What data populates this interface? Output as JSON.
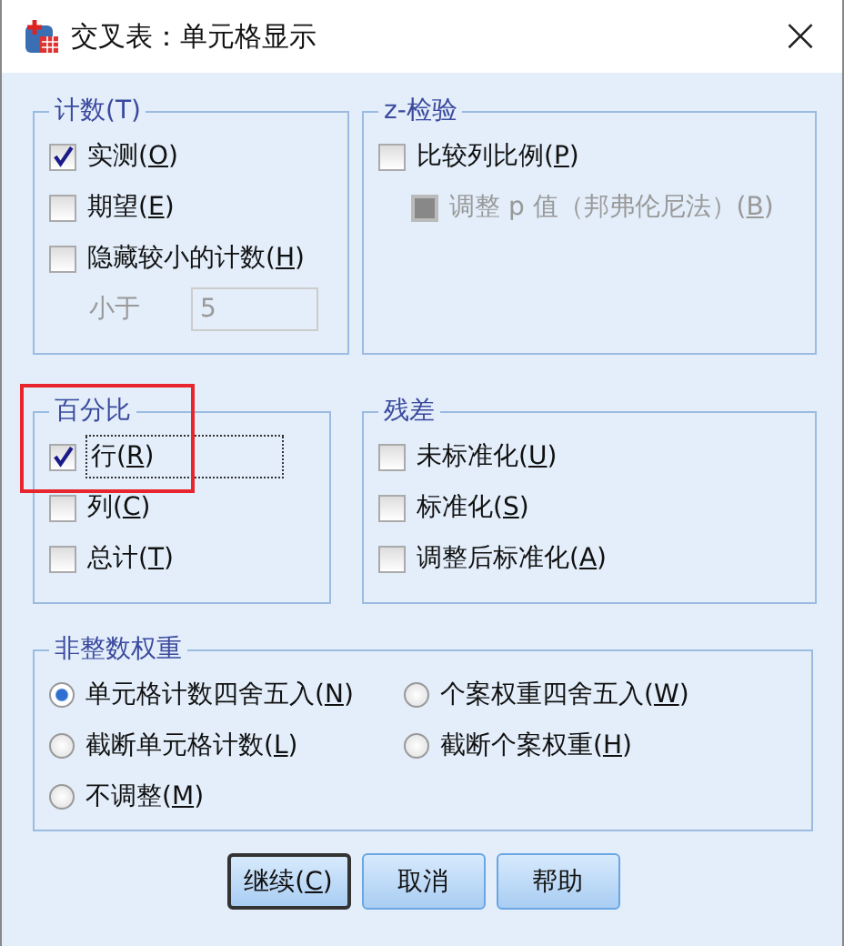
{
  "window": {
    "title": "交叉表：单元格显示",
    "close": "×"
  },
  "counts": {
    "legend": "计数(T)",
    "items": [
      {
        "before": "实测(",
        "mnemonic": "O",
        "after": ")",
        "checked": true,
        "disabled": false
      },
      {
        "before": "期望(",
        "mnemonic": "E",
        "after": ")",
        "checked": false,
        "disabled": false
      },
      {
        "before": "隐藏较小的计数(",
        "mnemonic": "H",
        "after": ")",
        "checked": false,
        "disabled": false
      }
    ],
    "less_than": {
      "label": "小于",
      "value": "5",
      "disabled": true
    }
  },
  "z_test": {
    "legend": "z-检验",
    "items": [
      {
        "before": "比较列比例(",
        "mnemonic": "P",
        "after": ")",
        "checked": false,
        "disabled": false,
        "children": [
          {
            "before": "调整 p 值（邦弗伦尼法）(",
            "mnemonic": "B",
            "after": ")",
            "checked": false,
            "disabled": true
          }
        ]
      }
    ]
  },
  "percentages": {
    "legend": "百分比",
    "highlighted": true,
    "items": [
      {
        "before": "行(",
        "mnemonic": "R",
        "after": ")",
        "checked": true,
        "disabled": false,
        "focused": true
      },
      {
        "before": "列(",
        "mnemonic": "C",
        "after": ")",
        "checked": false,
        "disabled": false,
        "focused": false
      },
      {
        "before": "总计(",
        "mnemonic": "T",
        "after": ")",
        "checked": false,
        "disabled": false,
        "focused": false
      }
    ]
  },
  "residuals": {
    "legend": "残差",
    "items": [
      {
        "before": "未标准化(",
        "mnemonic": "U",
        "after": ")",
        "checked": false,
        "disabled": false
      },
      {
        "before": "标准化(",
        "mnemonic": "S",
        "after": ")",
        "checked": false,
        "disabled": false
      },
      {
        "before": "调整后标准化(",
        "mnemonic": "A",
        "after": ")",
        "checked": false,
        "disabled": false
      }
    ]
  },
  "noninteger_weights": {
    "legend": "非整数权重",
    "options": [
      {
        "before": "单元格计数四舍五入(",
        "mnemonic": "N",
        "after": ")",
        "selected": true
      },
      {
        "before": "个案权重四舍五入(",
        "mnemonic": "W",
        "after": ")",
        "selected": false
      },
      {
        "before": "截断单元格计数(",
        "mnemonic": "L",
        "after": ")",
        "selected": false
      },
      {
        "before": "截断个案权重(",
        "mnemonic": "H",
        "after": ")",
        "selected": false
      },
      {
        "before": "不调整(",
        "mnemonic": "M",
        "after": ")",
        "selected": false
      }
    ]
  },
  "buttons": [
    {
      "before": "继续(",
      "mnemonic": "C",
      "after": ")",
      "default": true
    },
    {
      "before": "取消",
      "default": false
    },
    {
      "before": "帮助",
      "default": false
    }
  ]
}
